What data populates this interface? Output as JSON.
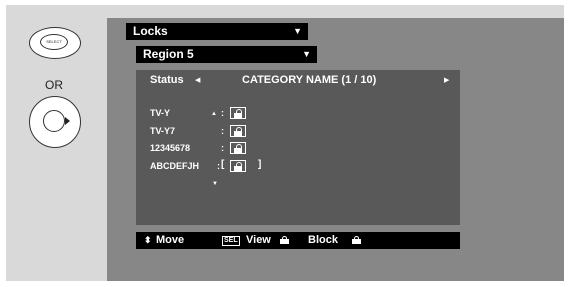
{
  "remote": {
    "select_label": "SELECT",
    "or_label": "OR"
  },
  "menu": {
    "locks_label": "Locks",
    "region_label": "Region 5"
  },
  "category": {
    "status_label": "Status",
    "title": "CATEGORY NAME (1 / 10)",
    "rows": [
      "TV-Y",
      "TV-Y7",
      "12345678",
      "ABCDEFJH"
    ]
  },
  "footer": {
    "move_label": "Move",
    "sel_icon_text": "SEL",
    "view_label": "View",
    "block_label": "Block"
  }
}
